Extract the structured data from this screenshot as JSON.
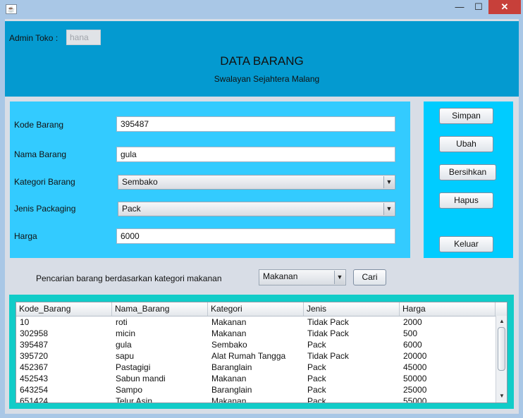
{
  "window": {
    "icon": "java-icon",
    "min": "—",
    "max": "☐",
    "close": "✕"
  },
  "header": {
    "admin_label": "Admin Toko  :",
    "admin_value": "hana",
    "title": "DATA BARANG",
    "subtitle": "Swalayan Sejahtera Malang",
    "color": "#049ad0"
  },
  "form": {
    "kode_label": "Kode Barang",
    "kode_value": "395487",
    "nama_label": "Nama Barang",
    "nama_value": "gula",
    "kategori_label": "Kategori Barang",
    "kategori_value": "Sembako",
    "jenis_label": "Jenis Packaging",
    "jenis_value": "Pack",
    "harga_label": "Harga",
    "harga_value": "6000"
  },
  "buttons": {
    "simpan": "Simpan",
    "ubah": "Ubah",
    "bersihkan": "Bersihkan",
    "hapus": "Hapus",
    "keluar": "Keluar"
  },
  "search": {
    "label": "Pencarian barang berdasarkan kategori makanan",
    "value": "Makanan",
    "cari": "Cari"
  },
  "table": {
    "columns": [
      "Kode_Barang",
      "Nama_Barang",
      "Kategori",
      "Jenis",
      "Harga"
    ],
    "rows": [
      [
        "10",
        "roti",
        "Makanan",
        "Tidak Pack",
        "2000"
      ],
      [
        "302958",
        "micin",
        "Makanan",
        "Tidak Pack",
        "500"
      ],
      [
        "395487",
        "gula",
        "Sembako",
        "Pack",
        "6000"
      ],
      [
        "395720",
        "sapu",
        "Alat Rumah Tangga",
        "Tidak Pack",
        "20000"
      ],
      [
        "452367",
        "Pastagigi",
        "Baranglain",
        "Pack",
        "45000"
      ],
      [
        "452543",
        "Sabun mandi",
        "Makanan",
        "Pack",
        "50000"
      ],
      [
        "643254",
        "Sampo",
        "Baranglain",
        "Pack",
        "25000"
      ],
      [
        "651424",
        "Telur Asin",
        "Makanan",
        "Pack",
        "55000"
      ]
    ]
  },
  "colors": {
    "form_panel": "#33cbff",
    "button_panel": "#00ccff",
    "table_panel": "#11ccc8"
  }
}
